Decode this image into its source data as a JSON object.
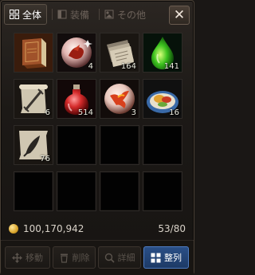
{
  "tabs": [
    {
      "label": "全体",
      "icon": "grid-icon",
      "active": true
    },
    {
      "label": "装備",
      "icon": "equipment-icon",
      "active": false
    },
    {
      "label": "その他",
      "icon": "misc-icon",
      "active": false
    }
  ],
  "close_label": "✕",
  "slots": [
    {
      "item": "brown-book",
      "count": ""
    },
    {
      "item": "dragon-orb",
      "count": "4"
    },
    {
      "item": "paper-scrolls",
      "count": "164"
    },
    {
      "item": "green-drop",
      "count": "141"
    },
    {
      "item": "sword-scroll",
      "count": "6"
    },
    {
      "item": "red-potion",
      "count": "514"
    },
    {
      "item": "phoenix-orb",
      "count": "3"
    },
    {
      "item": "food-plate",
      "count": "16"
    },
    {
      "item": "feather-scroll",
      "count": "76"
    },
    {
      "item": "",
      "count": ""
    },
    {
      "item": "",
      "count": ""
    },
    {
      "item": "",
      "count": ""
    },
    {
      "item": "",
      "count": ""
    },
    {
      "item": "",
      "count": ""
    },
    {
      "item": "",
      "count": ""
    },
    {
      "item": "",
      "count": ""
    }
  ],
  "money": "100,170,942",
  "capacity": "53/80",
  "buttons": {
    "move": "移動",
    "delete": "削除",
    "detail": "詳細",
    "sort": "整列"
  },
  "colors": {
    "accent": "#2a4f86",
    "background": "#1c1916"
  }
}
